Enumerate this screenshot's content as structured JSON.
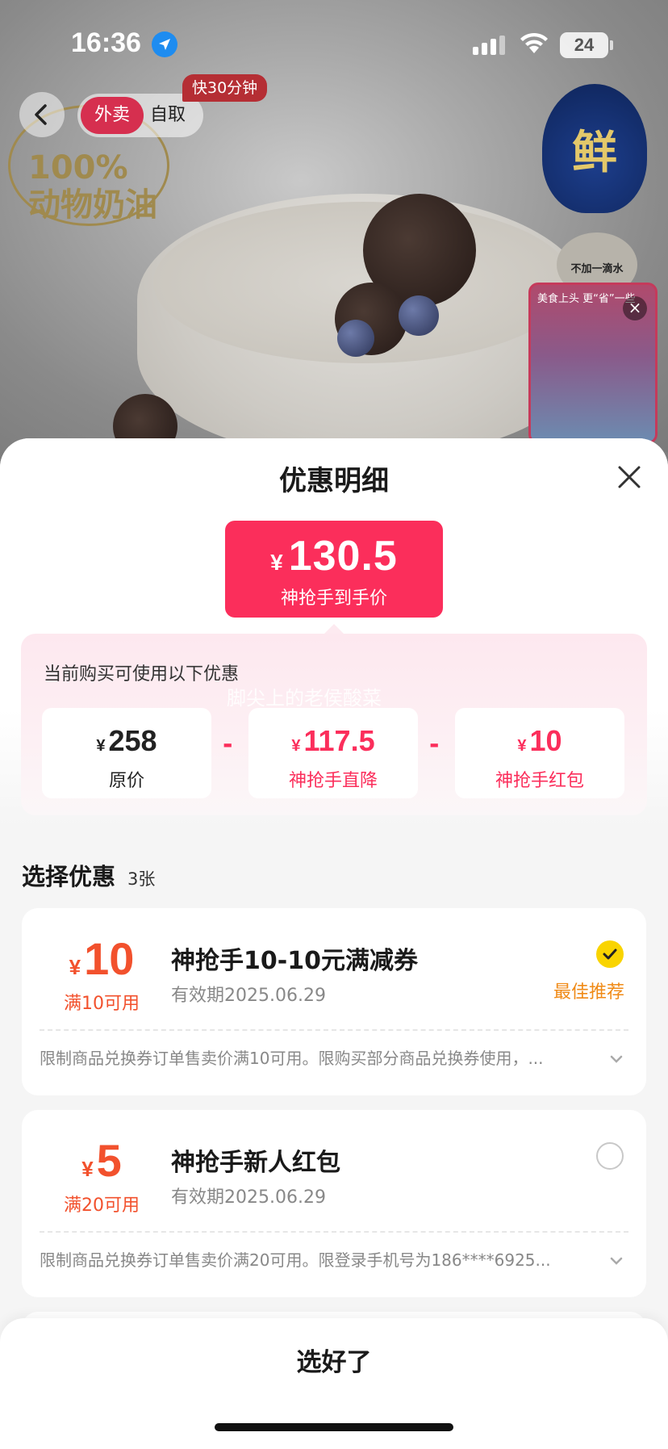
{
  "status_bar": {
    "time": "16:36",
    "battery": "24"
  },
  "background": {
    "ring_text": "100%\n动物奶油",
    "fresh_badge": "鲜",
    "no_water": "不加一滴水",
    "video_title": "美食上头 更“省”一些"
  },
  "nav": {
    "mode_delivery": "外卖",
    "mode_pickup": "自取",
    "fast_tag": "快30分钟"
  },
  "sheet": {
    "title": "优惠明细",
    "final_price": {
      "currency": "¥",
      "amount": "130.5",
      "label": "神抢手到手价"
    },
    "breakdown": {
      "title": "当前购买可使用以下优惠",
      "watermark": "脚尖上的老侯酸菜",
      "minus": "-",
      "items": [
        {
          "currency": "¥",
          "value": "258",
          "label": "原价"
        },
        {
          "currency": "¥",
          "value": "117.5",
          "label": "神抢手直降"
        },
        {
          "currency": "¥",
          "value": "10",
          "label": "神抢手红包"
        }
      ]
    },
    "select": {
      "title": "选择优惠",
      "count": "3张"
    },
    "coupons": [
      {
        "currency": "¥",
        "amount": "10",
        "condition": "满10可用",
        "name": "神抢手10-10元满减券",
        "expiry": "有效期2025.06.29",
        "selected": true,
        "badge": "最佳推荐",
        "rule": "限制商品兑换券订单售卖价满10可用。限购买部分商品兑换券使用，..."
      },
      {
        "currency": "¥",
        "amount": "5",
        "condition": "满20可用",
        "name": "神抢手新人红包",
        "expiry": "有效期2025.06.29",
        "selected": false,
        "badge": "",
        "rule": "限制商品兑换券订单售卖价满20可用。限登录手机号为186****6925..."
      }
    ],
    "confirm_label": "选好了"
  },
  "colors": {
    "accent": "#fb2e5b",
    "coupon_red": "#f2512d",
    "check_yellow": "#f9d400",
    "best_orange": "#f08a16"
  }
}
